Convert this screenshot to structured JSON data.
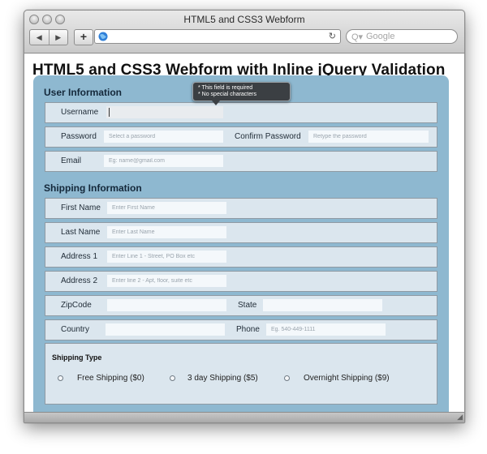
{
  "window": {
    "title": "HTML5 and CSS3 Webform"
  },
  "toolbar": {
    "back_icon": "back-arrow-icon",
    "forward_icon": "forward-arrow-icon",
    "add_label": "+",
    "reload_icon": "reload-icon",
    "search_placeholder": "Google",
    "search_icon_label": "Q▾"
  },
  "page": {
    "title": "HTML5 and CSS3 Webform with Inline jQuery Validation",
    "accent_color": "#8eb8d0"
  },
  "tooltip": {
    "lines": [
      "* This field is required",
      "* No special characters"
    ]
  },
  "user_section": {
    "title": "User Information",
    "username": {
      "label": "Username",
      "value": ""
    },
    "password": {
      "label": "Password",
      "placeholder": "Select a password"
    },
    "confirm": {
      "label": "Confirm Password",
      "placeholder": "Retype the password"
    },
    "email": {
      "label": "Email",
      "placeholder": "Eg: name@gmail.com"
    }
  },
  "shipping_section": {
    "title": "Shipping Information",
    "first_name": {
      "label": "First Name",
      "placeholder": "Enter First Name"
    },
    "last_name": {
      "label": "Last Name",
      "placeholder": "Enter Last Name"
    },
    "address1": {
      "label": "Address 1",
      "placeholder": "Enter Line 1 - Street, PO Box etc"
    },
    "address2": {
      "label": "Address 2",
      "placeholder": "Enter line 2 - Apt, floor, suite etc"
    },
    "zipcode": {
      "label": "ZipCode",
      "placeholder": ""
    },
    "state": {
      "label": "State",
      "placeholder": ""
    },
    "country": {
      "label": "Country",
      "placeholder": ""
    },
    "phone": {
      "label": "Phone",
      "placeholder": "Eg. 540-449-1111"
    },
    "shipping_type": {
      "title": "Shipping Type",
      "options": [
        "Free Shipping ($0)",
        "3 day Shipping ($5)",
        "Overnight Shipping ($9)"
      ]
    }
  }
}
